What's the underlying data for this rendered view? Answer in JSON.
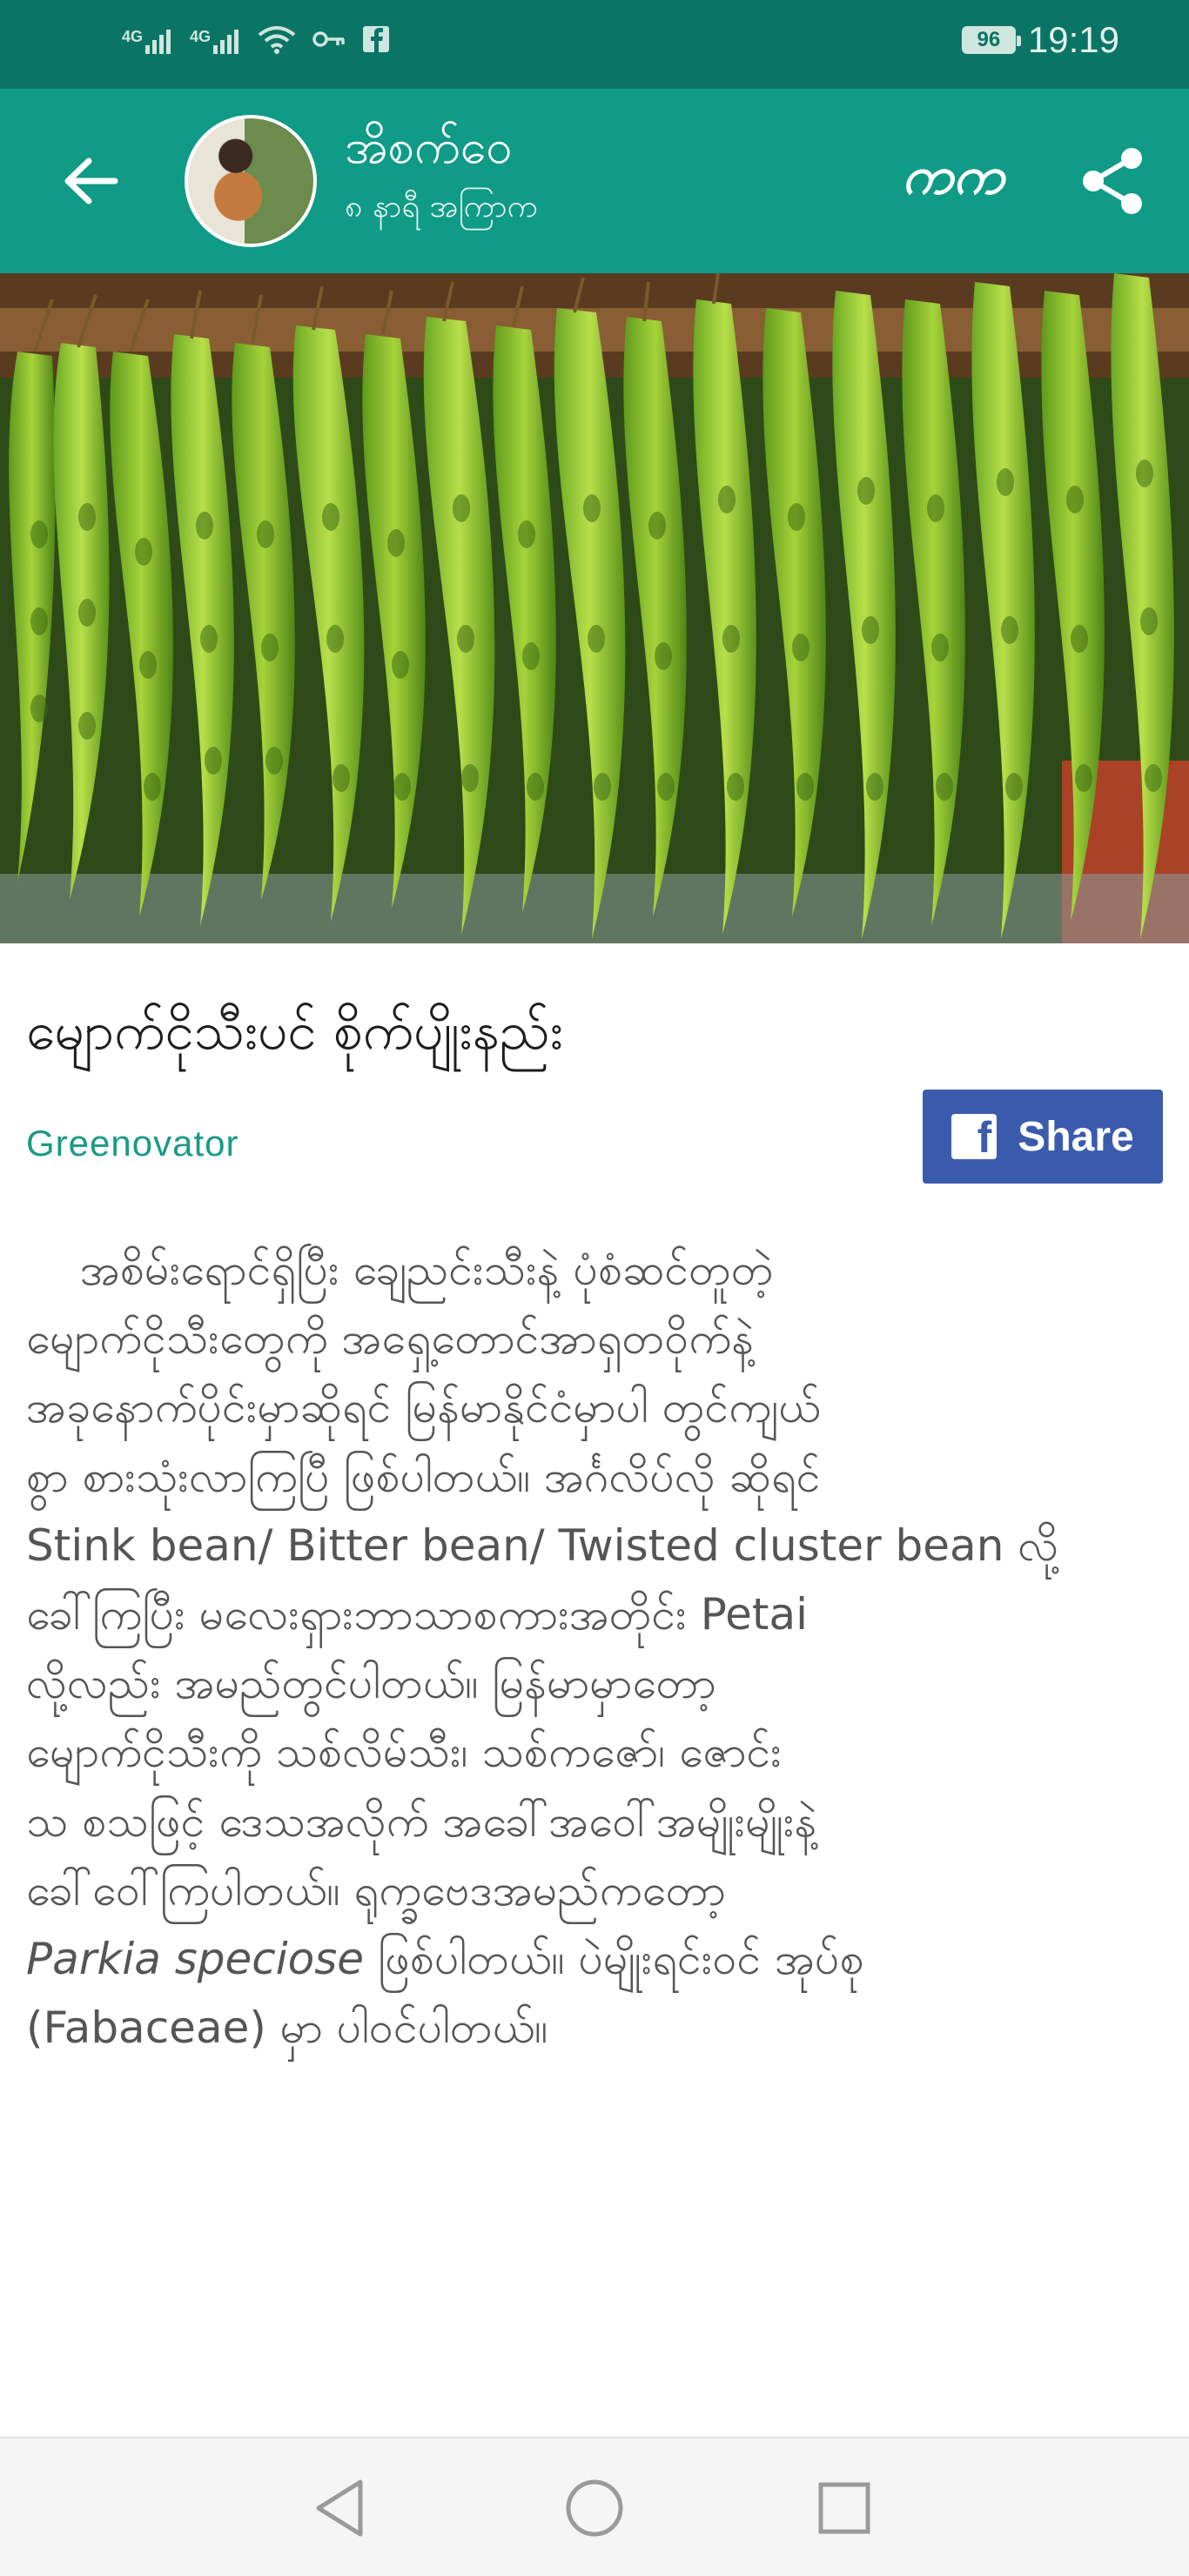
{
  "status_bar": {
    "network_1": "4G",
    "network_2": "4G",
    "battery": "96",
    "time": "19:19",
    "icons": [
      "signal-icon",
      "signal-icon",
      "wifi-icon",
      "key-icon",
      "notification-app-icon"
    ]
  },
  "header": {
    "author_name": "အိစက်ဝေ",
    "post_time": "၈ နာရီ အကြာက",
    "font_button": "ကက",
    "background_color": "#0f9b86",
    "status_bar_color": "#0b7565"
  },
  "article": {
    "title": "မျောက်ငိုသီးပင် စိုက်ပျိုးနည်း",
    "author_link": "Greenovator",
    "share_label": "Share",
    "share_icon": "f",
    "share_color": "#3b5cad",
    "body_lines": [
      "အစိမ်းရောင်ရှိပြီး ချေညင်းသီးနဲ့ ပုံစံဆင်တူတဲ့",
      "မျောက်ငိုသီးတွေကို အရှေ့တောင်အာရှတဝိုက်နဲ့",
      "အခုနောက်ပိုင်းမှာဆိုရင် မြန်မာနိုင်ငံမှာပါ တွင်ကျယ်",
      "စွာ စားသုံးလာကြပြီ ဖြစ်ပါတယ်။ အင်္ဂလိပ်လို ဆိုရင်",
      "Stink bean/ Bitter bean/ Twisted cluster bean လို့",
      "ခေါ်ကြပြီး မလေးရှားဘာသာစကားအတိုင်း Petai",
      "လို့လည်း အမည်တွင်ပါတယ်။ မြန်မာမှာတော့",
      "မျောက်ငိုသီးကို သစ်လိမ်သီး၊ သစ်ကဇော်၊ ဇောင်း",
      "သ စသဖြင့် ဒေသအလိုက် အခေါ်အဝေါ်အမျိုးမျိုးနဲ့",
      "ခေါ်ဝေါ်ကြပါတယ်။ ရုက္ခဗေဒအမည်ကတော့"
    ],
    "scientific_name": "Parkia speciose",
    "line_11_rest": " ဖြစ်ပါတယ်။ ပဲမျိုးရင်းဝင် အုပ်စု",
    "line_12": "(Fabaceae) မှာ ပါဝင်ပါတယ်။"
  },
  "nav_bar": {
    "buttons": [
      "back-nav-icon",
      "home-nav-icon",
      "recents-nav-icon"
    ]
  }
}
